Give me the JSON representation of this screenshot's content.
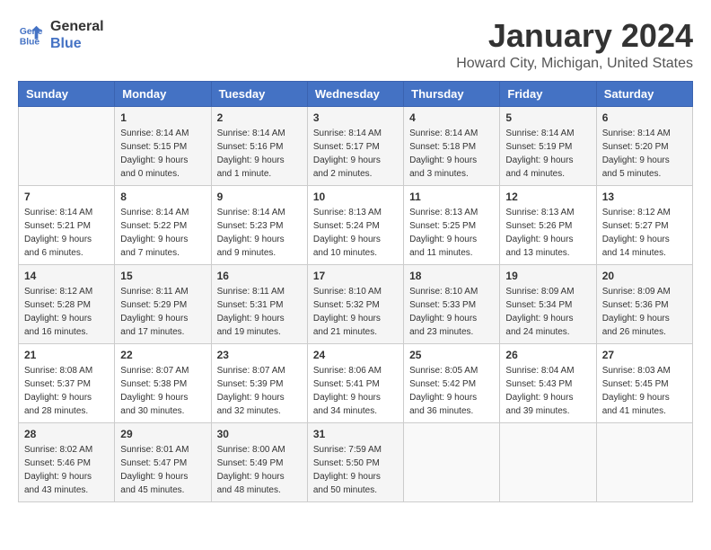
{
  "header": {
    "logo_line1": "General",
    "logo_line2": "Blue",
    "month": "January 2024",
    "location": "Howard City, Michigan, United States"
  },
  "weekdays": [
    "Sunday",
    "Monday",
    "Tuesday",
    "Wednesday",
    "Thursday",
    "Friday",
    "Saturday"
  ],
  "weeks": [
    [
      {
        "day": "",
        "content": ""
      },
      {
        "day": "1",
        "sunrise": "Sunrise: 8:14 AM",
        "sunset": "Sunset: 5:15 PM",
        "daylight": "Daylight: 9 hours and 0 minutes."
      },
      {
        "day": "2",
        "sunrise": "Sunrise: 8:14 AM",
        "sunset": "Sunset: 5:16 PM",
        "daylight": "Daylight: 9 hours and 1 minute."
      },
      {
        "day": "3",
        "sunrise": "Sunrise: 8:14 AM",
        "sunset": "Sunset: 5:17 PM",
        "daylight": "Daylight: 9 hours and 2 minutes."
      },
      {
        "day": "4",
        "sunrise": "Sunrise: 8:14 AM",
        "sunset": "Sunset: 5:18 PM",
        "daylight": "Daylight: 9 hours and 3 minutes."
      },
      {
        "day": "5",
        "sunrise": "Sunrise: 8:14 AM",
        "sunset": "Sunset: 5:19 PM",
        "daylight": "Daylight: 9 hours and 4 minutes."
      },
      {
        "day": "6",
        "sunrise": "Sunrise: 8:14 AM",
        "sunset": "Sunset: 5:20 PM",
        "daylight": "Daylight: 9 hours and 5 minutes."
      }
    ],
    [
      {
        "day": "7",
        "sunrise": "Sunrise: 8:14 AM",
        "sunset": "Sunset: 5:21 PM",
        "daylight": "Daylight: 9 hours and 6 minutes."
      },
      {
        "day": "8",
        "sunrise": "Sunrise: 8:14 AM",
        "sunset": "Sunset: 5:22 PM",
        "daylight": "Daylight: 9 hours and 7 minutes."
      },
      {
        "day": "9",
        "sunrise": "Sunrise: 8:14 AM",
        "sunset": "Sunset: 5:23 PM",
        "daylight": "Daylight: 9 hours and 9 minutes."
      },
      {
        "day": "10",
        "sunrise": "Sunrise: 8:13 AM",
        "sunset": "Sunset: 5:24 PM",
        "daylight": "Daylight: 9 hours and 10 minutes."
      },
      {
        "day": "11",
        "sunrise": "Sunrise: 8:13 AM",
        "sunset": "Sunset: 5:25 PM",
        "daylight": "Daylight: 9 hours and 11 minutes."
      },
      {
        "day": "12",
        "sunrise": "Sunrise: 8:13 AM",
        "sunset": "Sunset: 5:26 PM",
        "daylight": "Daylight: 9 hours and 13 minutes."
      },
      {
        "day": "13",
        "sunrise": "Sunrise: 8:12 AM",
        "sunset": "Sunset: 5:27 PM",
        "daylight": "Daylight: 9 hours and 14 minutes."
      }
    ],
    [
      {
        "day": "14",
        "sunrise": "Sunrise: 8:12 AM",
        "sunset": "Sunset: 5:28 PM",
        "daylight": "Daylight: 9 hours and 16 minutes."
      },
      {
        "day": "15",
        "sunrise": "Sunrise: 8:11 AM",
        "sunset": "Sunset: 5:29 PM",
        "daylight": "Daylight: 9 hours and 17 minutes."
      },
      {
        "day": "16",
        "sunrise": "Sunrise: 8:11 AM",
        "sunset": "Sunset: 5:31 PM",
        "daylight": "Daylight: 9 hours and 19 minutes."
      },
      {
        "day": "17",
        "sunrise": "Sunrise: 8:10 AM",
        "sunset": "Sunset: 5:32 PM",
        "daylight": "Daylight: 9 hours and 21 minutes."
      },
      {
        "day": "18",
        "sunrise": "Sunrise: 8:10 AM",
        "sunset": "Sunset: 5:33 PM",
        "daylight": "Daylight: 9 hours and 23 minutes."
      },
      {
        "day": "19",
        "sunrise": "Sunrise: 8:09 AM",
        "sunset": "Sunset: 5:34 PM",
        "daylight": "Daylight: 9 hours and 24 minutes."
      },
      {
        "day": "20",
        "sunrise": "Sunrise: 8:09 AM",
        "sunset": "Sunset: 5:36 PM",
        "daylight": "Daylight: 9 hours and 26 minutes."
      }
    ],
    [
      {
        "day": "21",
        "sunrise": "Sunrise: 8:08 AM",
        "sunset": "Sunset: 5:37 PM",
        "daylight": "Daylight: 9 hours and 28 minutes."
      },
      {
        "day": "22",
        "sunrise": "Sunrise: 8:07 AM",
        "sunset": "Sunset: 5:38 PM",
        "daylight": "Daylight: 9 hours and 30 minutes."
      },
      {
        "day": "23",
        "sunrise": "Sunrise: 8:07 AM",
        "sunset": "Sunset: 5:39 PM",
        "daylight": "Daylight: 9 hours and 32 minutes."
      },
      {
        "day": "24",
        "sunrise": "Sunrise: 8:06 AM",
        "sunset": "Sunset: 5:41 PM",
        "daylight": "Daylight: 9 hours and 34 minutes."
      },
      {
        "day": "25",
        "sunrise": "Sunrise: 8:05 AM",
        "sunset": "Sunset: 5:42 PM",
        "daylight": "Daylight: 9 hours and 36 minutes."
      },
      {
        "day": "26",
        "sunrise": "Sunrise: 8:04 AM",
        "sunset": "Sunset: 5:43 PM",
        "daylight": "Daylight: 9 hours and 39 minutes."
      },
      {
        "day": "27",
        "sunrise": "Sunrise: 8:03 AM",
        "sunset": "Sunset: 5:45 PM",
        "daylight": "Daylight: 9 hours and 41 minutes."
      }
    ],
    [
      {
        "day": "28",
        "sunrise": "Sunrise: 8:02 AM",
        "sunset": "Sunset: 5:46 PM",
        "daylight": "Daylight: 9 hours and 43 minutes."
      },
      {
        "day": "29",
        "sunrise": "Sunrise: 8:01 AM",
        "sunset": "Sunset: 5:47 PM",
        "daylight": "Daylight: 9 hours and 45 minutes."
      },
      {
        "day": "30",
        "sunrise": "Sunrise: 8:00 AM",
        "sunset": "Sunset: 5:49 PM",
        "daylight": "Daylight: 9 hours and 48 minutes."
      },
      {
        "day": "31",
        "sunrise": "Sunrise: 7:59 AM",
        "sunset": "Sunset: 5:50 PM",
        "daylight": "Daylight: 9 hours and 50 minutes."
      },
      {
        "day": "",
        "content": ""
      },
      {
        "day": "",
        "content": ""
      },
      {
        "day": "",
        "content": ""
      }
    ]
  ]
}
